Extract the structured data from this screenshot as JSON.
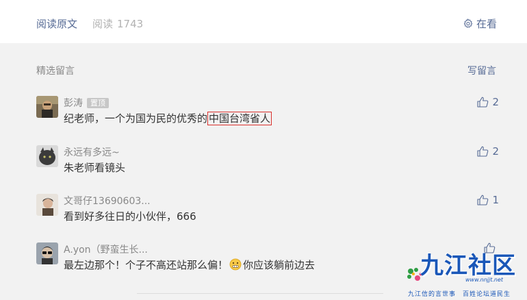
{
  "top": {
    "read_original": "阅读原文",
    "read_label": "阅读",
    "read_count": "1743",
    "zaikan_label": "在看"
  },
  "comments_header": {
    "title": "精选留言",
    "write_label": "写留言"
  },
  "comments": [
    {
      "nickname": "彭涛",
      "badge": "置顶",
      "text_before": "纪老师，一个为国为民的优秀的",
      "text_highlight": "中国台湾省人",
      "text_after": "",
      "likes": "2"
    },
    {
      "nickname": "永远有多远~",
      "text_before": "朱老师看镜头",
      "likes": "2"
    },
    {
      "nickname": "文哥仔13690603...",
      "text_before": "看到好多往日的小伙伴，666",
      "likes": "1"
    },
    {
      "nickname": "A.yon（野蛮生长...",
      "text_before": "最左边那个！个子不高还站那么偏！",
      "emoji": "grimace-emoji",
      "text_after": "你应该躺前边去",
      "likes": ""
    }
  ],
  "watermark": {
    "title": "九江社区",
    "site": "www.nnjjt.net",
    "slogan": "九江信的言世事　百姓论坛道民生"
  },
  "colors": {
    "link": "#576b95",
    "highlight_border": "#d9302c",
    "background": "#f2f2f2"
  }
}
